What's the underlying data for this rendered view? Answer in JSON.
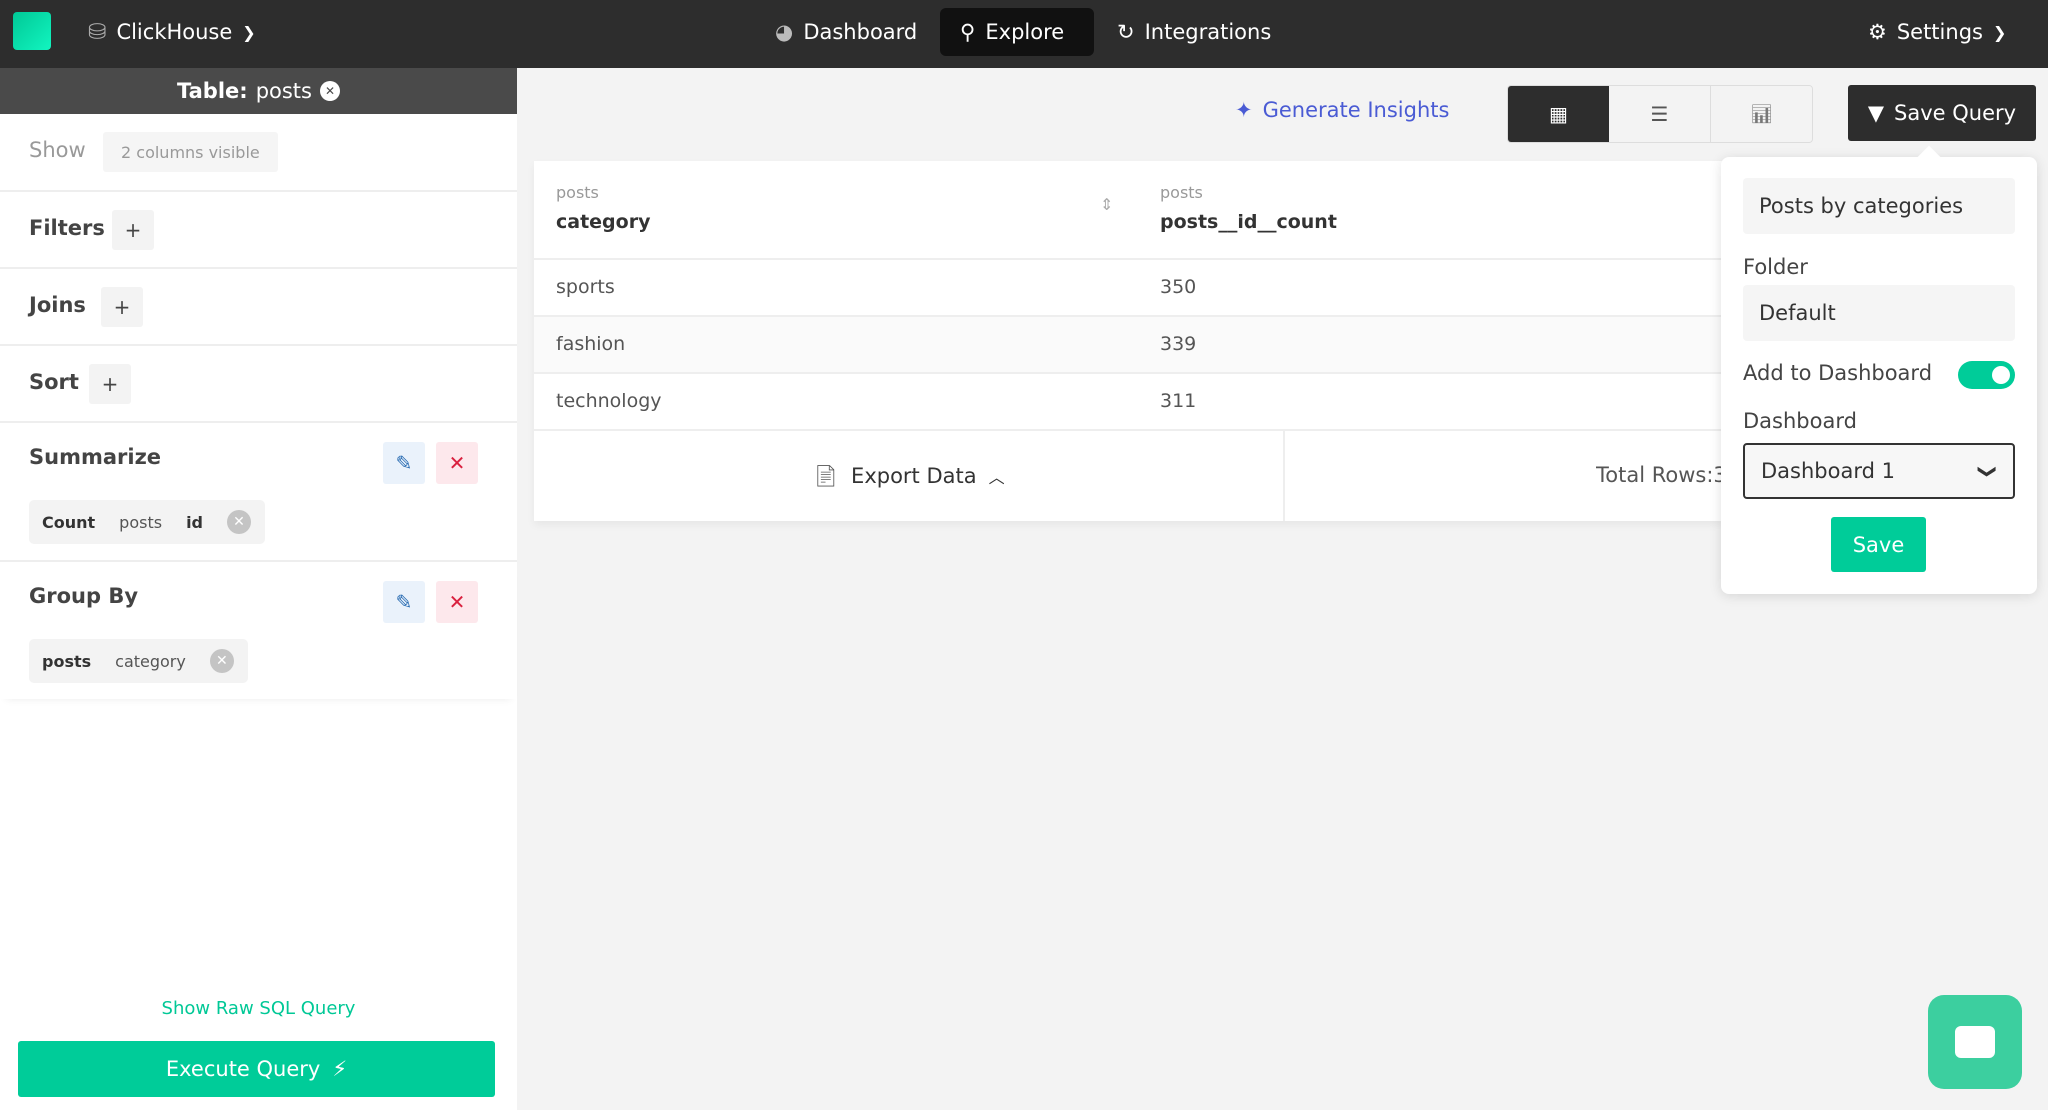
{
  "topbar": {
    "db_name": "ClickHouse",
    "nav": [
      {
        "label": "Dashboard"
      },
      {
        "label": "Explore",
        "active": true
      },
      {
        "label": "Integrations"
      }
    ],
    "settings": "Settings"
  },
  "sidebar": {
    "table_label": "Table:",
    "table_name": "posts",
    "show_label": "Show",
    "columns_visible": "2 columns visible",
    "filters": "Filters",
    "joins": "Joins",
    "sort": "Sort",
    "plus": "+",
    "summarize": {
      "title": "Summarize",
      "pill": [
        "Count",
        "posts",
        "id"
      ]
    },
    "group_by": {
      "title": "Group By",
      "pill": [
        "posts",
        "category"
      ]
    },
    "raw_sql": "Show Raw SQL Query",
    "execute": "Execute Query"
  },
  "toolbar": {
    "generate_insights": "Generate Insights",
    "save_query": "Save Query",
    "active_view": "table"
  },
  "table": {
    "columns": [
      {
        "table": "posts",
        "name": "category"
      },
      {
        "table": "posts",
        "name": "posts__id__count"
      }
    ],
    "rows": [
      [
        "sports",
        "350"
      ],
      [
        "fashion",
        "339"
      ],
      [
        "technology",
        "311"
      ]
    ],
    "export": "Export Data",
    "total_rows": "Total Rows:3"
  },
  "save_popover": {
    "name_value": "Posts by categories",
    "folder_label": "Folder",
    "folder_value": "Default",
    "add_to_dashboard_label": "Add to Dashboard",
    "add_to_dashboard": true,
    "dashboard_label": "Dashboard",
    "dashboard_value": "Dashboard 1",
    "save": "Save"
  },
  "colors": {
    "accent": "#00cc99",
    "topbar": "#2d2d2d",
    "insights": "#4a5bd4"
  }
}
